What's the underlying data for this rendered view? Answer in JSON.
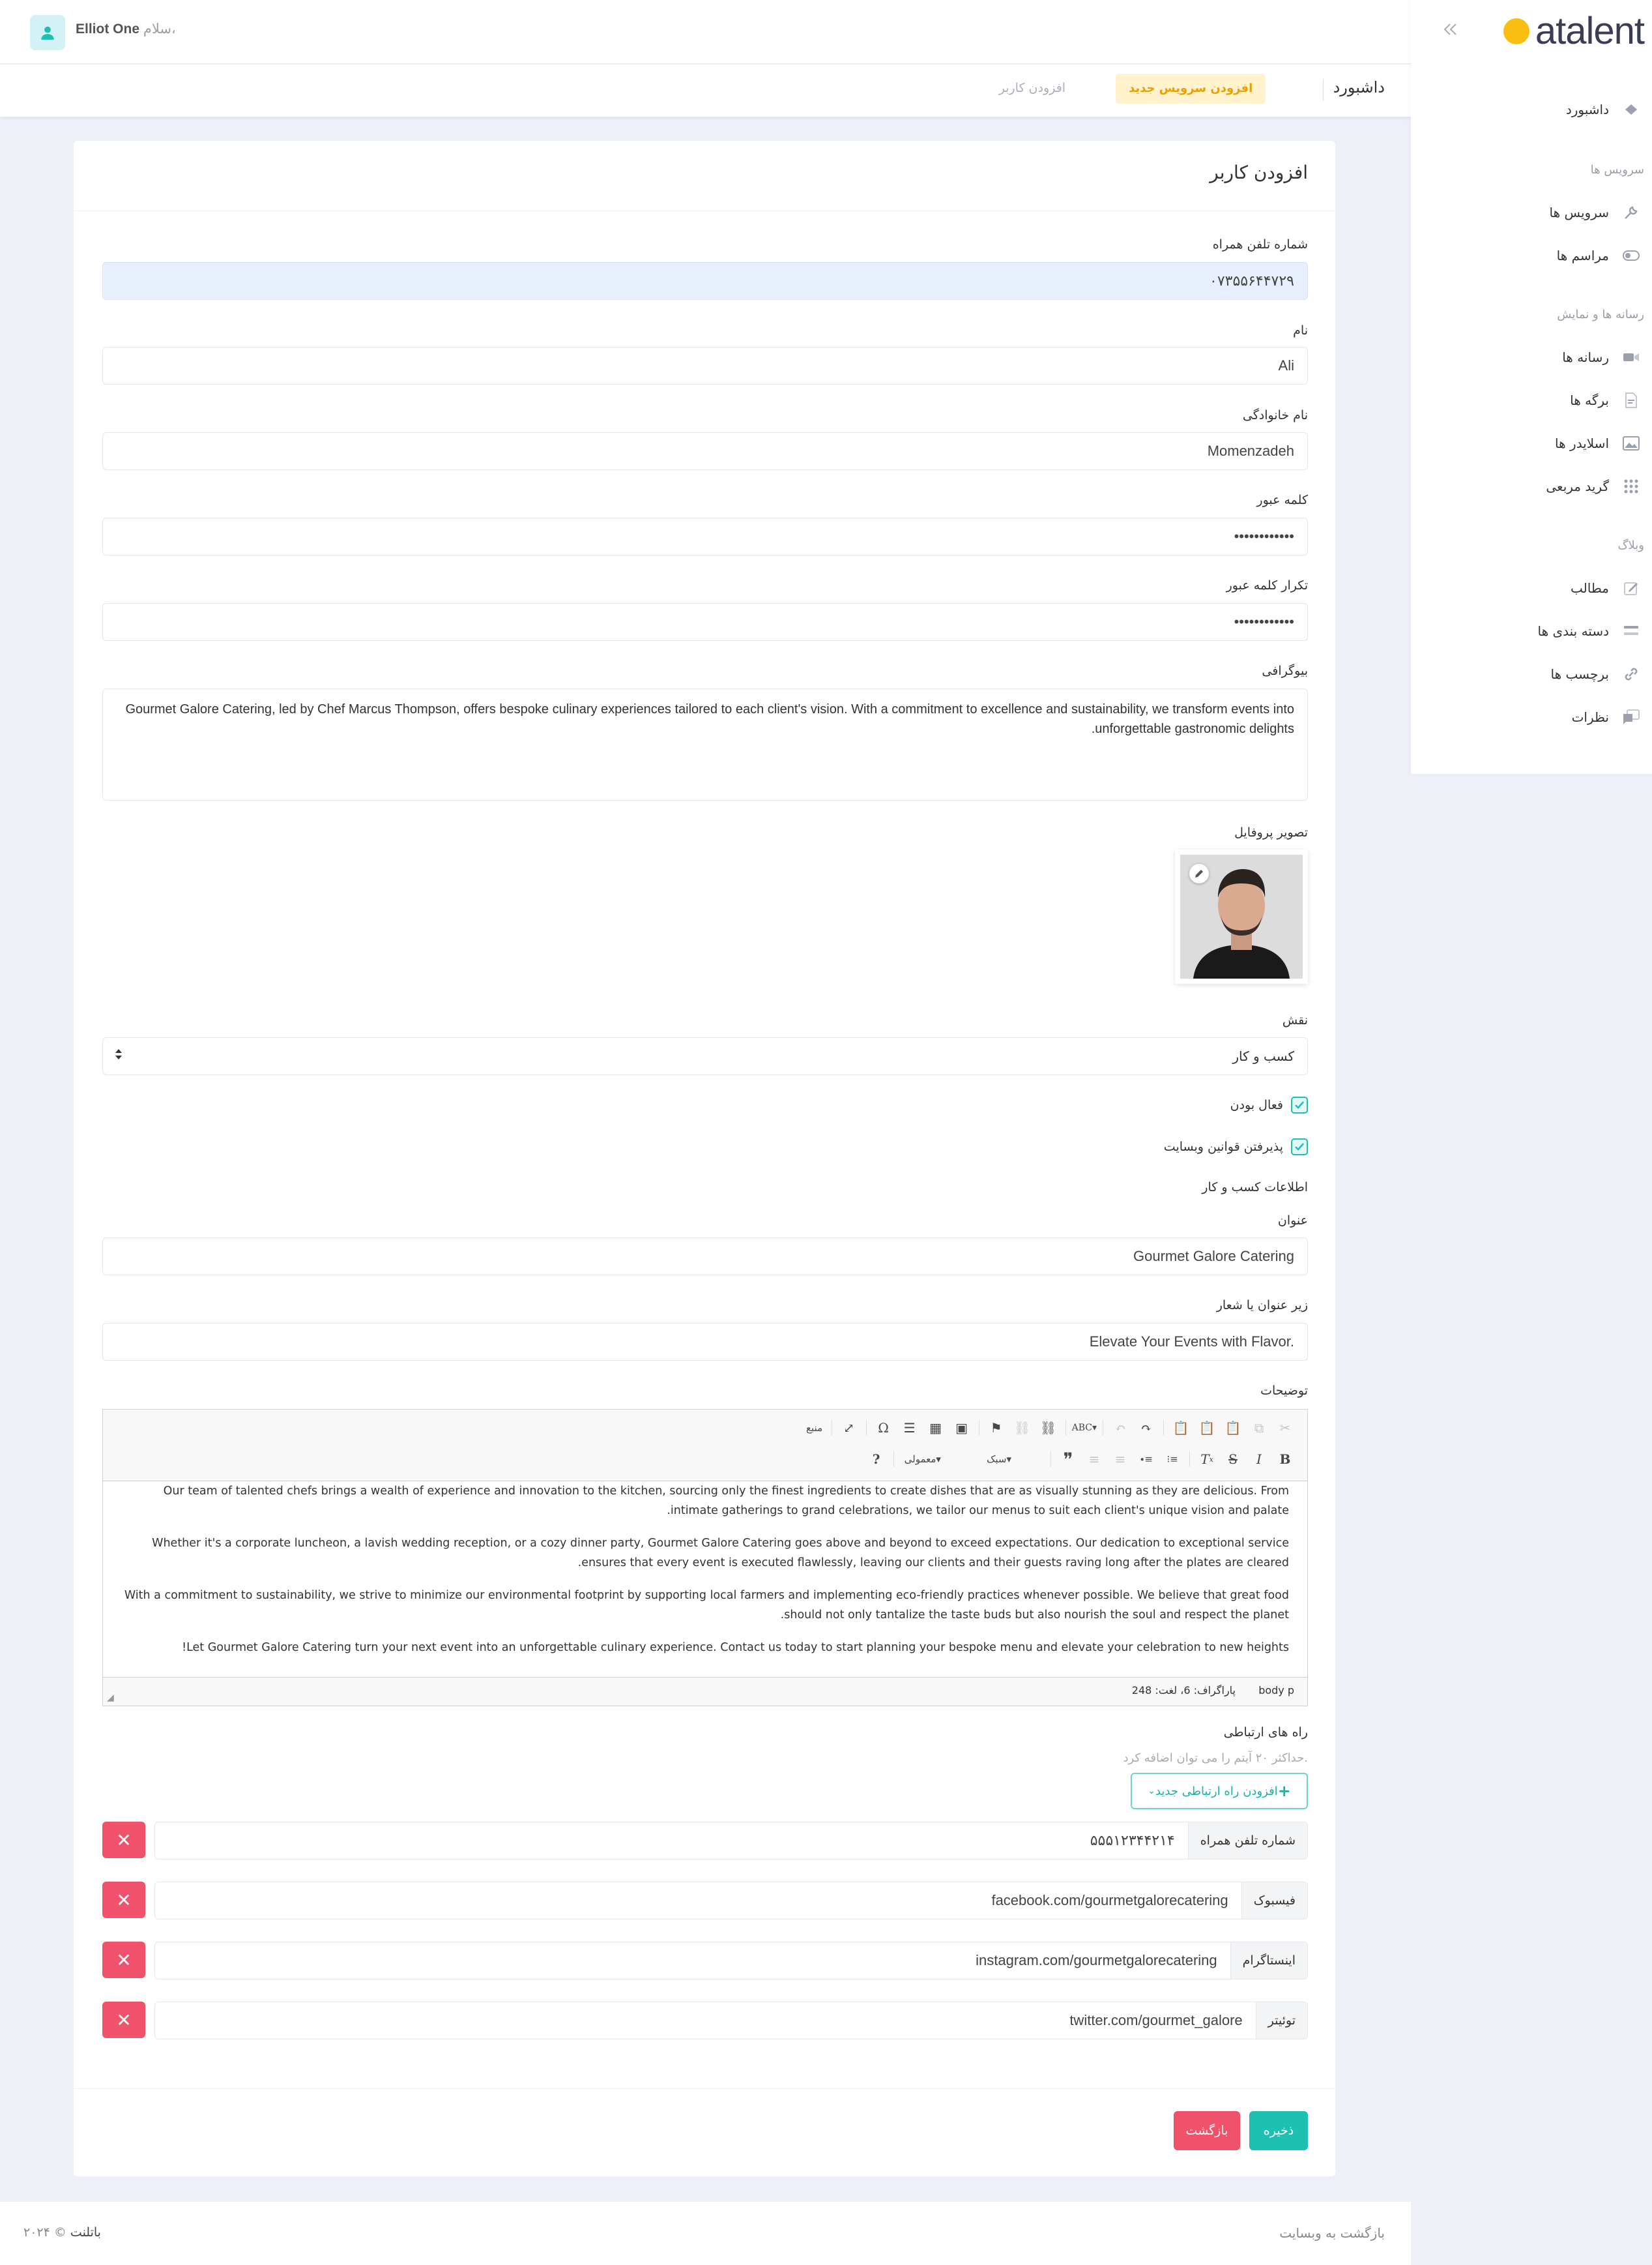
{
  "header": {
    "greeting": "سلام،",
    "user_name": "Elliot One"
  },
  "breadcrumb": {
    "title": "داشبورد",
    "link": "افزودن کاربر",
    "badge": "افزودن سرویس جدید"
  },
  "sidebar": {
    "logo": "atalent",
    "items": [
      {
        "label": "داشبورد",
        "icon": "dashboard-icon"
      },
      {
        "heading": "سرویس ها"
      },
      {
        "label": "سرویس ها",
        "icon": "wrench-icon"
      },
      {
        "label": "مراسم ها",
        "icon": "toggle-icon"
      },
      {
        "heading": "رسانه ها و نمایش"
      },
      {
        "label": "رسانه ها",
        "icon": "video-icon"
      },
      {
        "label": "برگه ها",
        "icon": "file-icon"
      },
      {
        "label": "اسلایدر ها",
        "icon": "image-icon"
      },
      {
        "label": "گرید مربعی",
        "icon": "grid-icon"
      },
      {
        "heading": "وبلاگ"
      },
      {
        "label": "مطالب",
        "icon": "edit-icon"
      },
      {
        "label": "دسته بندی ها",
        "icon": "list-icon"
      },
      {
        "label": "برچسب ها",
        "icon": "link-icon"
      },
      {
        "label": "نظرات",
        "icon": "comments-icon"
      }
    ]
  },
  "form": {
    "title": "افزودن کاربر",
    "phone_label": "شماره تلفن همراه",
    "phone_value": "۰۷۳۵۵۶۴۴۷۲۹",
    "first_name_label": "نام",
    "first_name_value": "Ali",
    "last_name_label": "نام خانوادگی",
    "last_name_value": "Momenzadeh",
    "password_label": "کلمه عبور",
    "password_value": "••••••••••••",
    "password_repeat_label": "تکرار کلمه عبور",
    "password_repeat_value": "••••••••••••",
    "bio_label": "بیوگرافی",
    "bio_value": "Gourmet Galore Catering, led by Chef Marcus Thompson, offers bespoke culinary experiences tailored to each client's vision. With a commitment to excellence and sustainability, we transform events into unforgettable gastronomic delights.",
    "photo_label": "تصویر پروفایل",
    "role_label": "نقش",
    "role_value": "کسب و کار",
    "active_label": "فعال بودن",
    "terms_label": "پذیرفتن قوانین وبسایت",
    "business_info_label": "اطلاعات کسب و کار",
    "biz_title_label": "عنوان",
    "biz_title_value": "Gourmet Galore Catering",
    "biz_subtitle_label": "زیر عنوان یا شعار",
    "biz_subtitle_value": "Elevate Your Events with Flavor.",
    "description_label": "توضیحات"
  },
  "editor": {
    "source_label": "منبع",
    "format_label": "سبک",
    "paragraph_format": "معمولی",
    "paragraphs": [
      "Our team of talented chefs brings a wealth of experience and innovation to the kitchen, sourcing only the finest ingredients to create dishes that are as visually stunning as they are delicious. From intimate gatherings to grand celebrations, we tailor our menus to suit each client's unique vision and palate.",
      "Whether it's a corporate luncheon, a lavish wedding reception, or a cozy dinner party, Gourmet Galore Catering goes above and beyond to exceed expectations. Our dedication to exceptional service ensures that every event is executed flawlessly, leaving our clients and their guests raving long after the plates are cleared.",
      "With a commitment to sustainability, we strive to minimize our environmental footprint by supporting local farmers and implementing eco-friendly practices whenever possible. We believe that great food should not only tantalize the taste buds but also nourish the soul and respect the planet.",
      "Let Gourmet Galore Catering turn your next event into an unforgettable culinary experience. Contact us today to start planning your bespoke menu and elevate your celebration to new heights!"
    ],
    "path": "body  p",
    "count": "پاراگراف: 6، لغت: 248"
  },
  "contacts": {
    "label": "راه های ارتباطی",
    "hint": "حداکثر ۲۰ آیتم را می توان اضافه کرد.",
    "add_button": "افزودن راه ارتباطی جدید",
    "items": [
      {
        "type": "شماره تلفن همراه",
        "value": "۵۵۵۱۲۳۴۴۲۱۴"
      },
      {
        "type": "فیسبوک",
        "value": "facebook.com/gourmetgalorecatering"
      },
      {
        "type": "اینستاگرام",
        "value": "instagram.com/gourmetgalorecatering"
      },
      {
        "type": "توئیتر",
        "value": "twitter.com/gourmet_galore"
      }
    ]
  },
  "actions": {
    "save": "ذخیره",
    "back": "بازگشت"
  },
  "footer": {
    "back_to_site": "بازگشت به وبسایت",
    "copyright": "© ۲۰۲۴",
    "brand": "باتلنت"
  },
  "colors": {
    "primary": "#1ec1b1",
    "danger": "#f0516b",
    "warning_bg": "#fff2cc",
    "warning_text": "#e7a100"
  }
}
